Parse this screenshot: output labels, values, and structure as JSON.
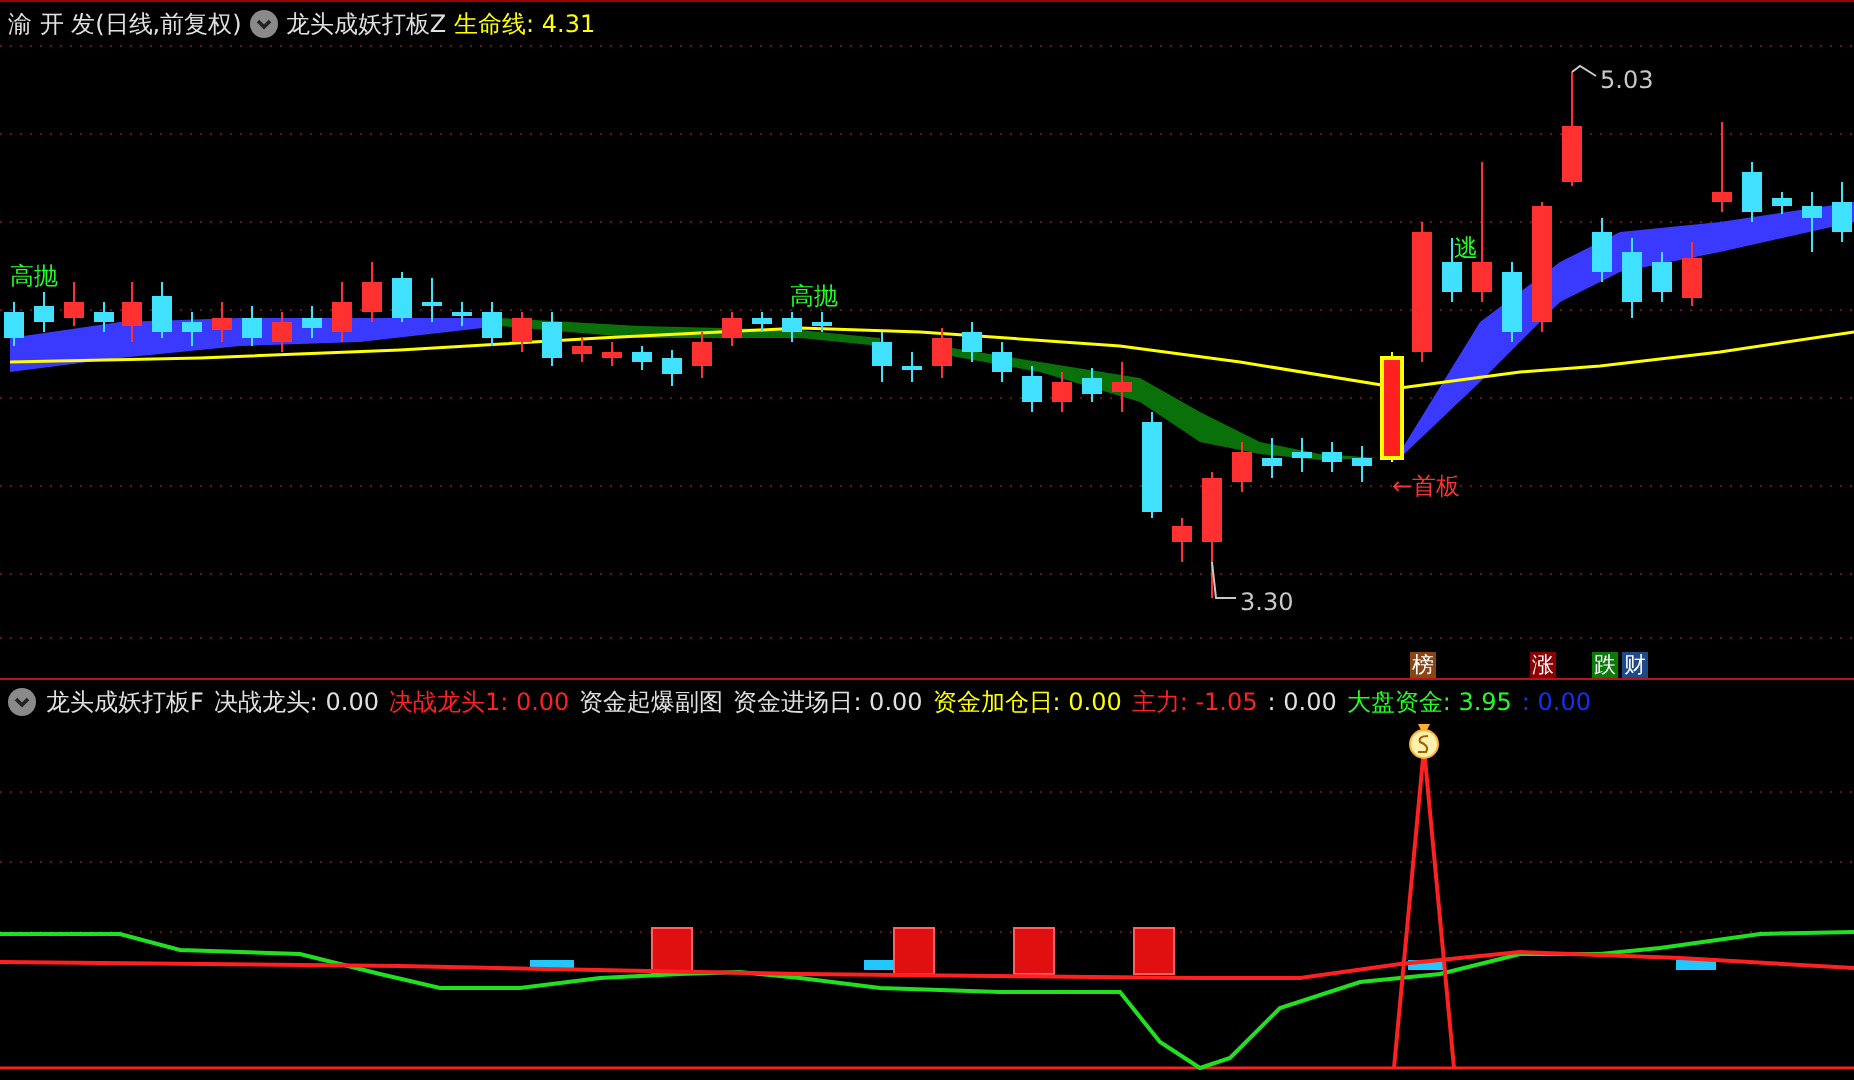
{
  "main_panel": {
    "stock": "渝 开 发(日线,前复权)",
    "indicator": "龙头成妖打板Z",
    "readings": [
      {
        "text": "生命线: 4.31",
        "color": "#ffff00"
      }
    ],
    "annotations": [
      {
        "kind": "sell",
        "text": "高抛"
      },
      {
        "kind": "sell",
        "text": "高抛"
      },
      {
        "kind": "escape",
        "text": "逃"
      },
      {
        "kind": "first_board",
        "text": "←首板"
      },
      {
        "kind": "high",
        "text": "5.03"
      },
      {
        "kind": "low",
        "text": "3.30"
      }
    ],
    "badges": [
      {
        "text": "榜",
        "color": "#8b4513"
      },
      {
        "text": "涨",
        "color": "#8b0000"
      },
      {
        "text": "跌",
        "color": "#0a7a0a"
      },
      {
        "text": "财",
        "color": "#1e4a8a"
      }
    ]
  },
  "sub_panel": {
    "indicator": "龙头成妖打板F",
    "readings": [
      {
        "text": "决战龙头: 0.00",
        "color": "#e0e0e0"
      },
      {
        "text": "决战龙头1: 0.00",
        "color": "#ff2020"
      },
      {
        "text": "资金起爆副图",
        "color": "#e0e0e0"
      },
      {
        "text": "资金进场日: 0.00",
        "color": "#e0e0e0"
      },
      {
        "text": "资金加仓日: 0.00",
        "color": "#ffff00"
      },
      {
        "text": "主力: -1.05",
        "color": "#ff2020"
      },
      {
        "text": ": 0.00",
        "color": "#e0e0e0"
      },
      {
        "text": "大盘资金: 3.95",
        "color": "#20ff20"
      },
      {
        "text": ": 0.00",
        "color": "#1030ff"
      }
    ]
  }
}
